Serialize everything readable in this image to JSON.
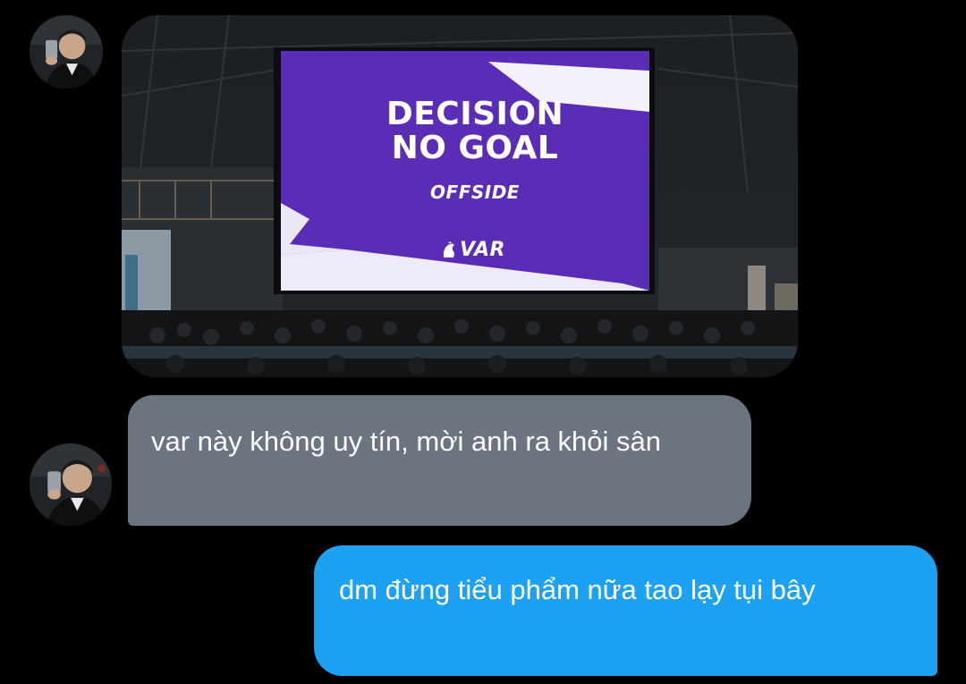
{
  "conversation": {
    "contact_avatar": "profile-photo",
    "messages": [
      {
        "type": "image",
        "direction": "received",
        "screen": {
          "title_line1": "DECISION",
          "title_line2": "NO GOAL",
          "subtitle": "OFFSIDE",
          "logo_text": "VAR",
          "background_color": "#5b2cb6"
        }
      },
      {
        "type": "text",
        "direction": "received",
        "text": "var này không uy tín, mời anh ra khỏi sân"
      },
      {
        "type": "text",
        "direction": "sent",
        "text": "dm đừng tiểu phẩm nữa tao lạy tụi bây"
      }
    ]
  },
  "colors": {
    "background": "#000000",
    "received_bubble": "#6b7480",
    "sent_bubble": "#1da1f2",
    "text": "#ffffff"
  }
}
